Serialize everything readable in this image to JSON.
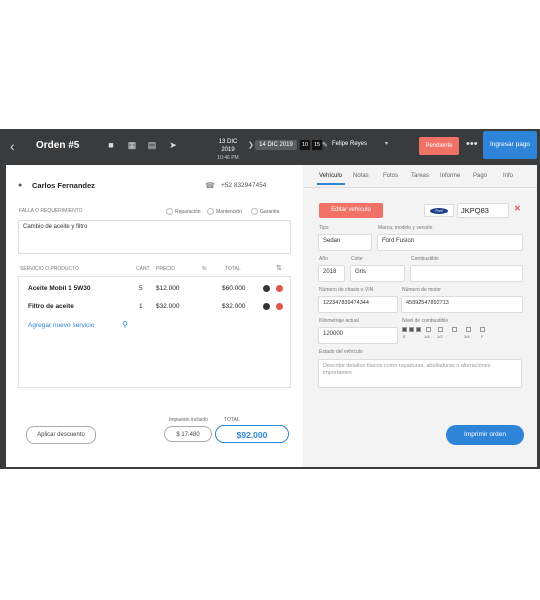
{
  "header": {
    "order_title": "Orden #5",
    "date_from_day": "13 DIC 2019",
    "date_from_time": "10:46 PM",
    "date_to": "14 DIC 2019",
    "hour": "10",
    "minute": "15",
    "user": "Felipe Reyes",
    "status_label": "Pendiente",
    "more": "•••",
    "pay_label": "Ingresar pago"
  },
  "customer": {
    "name": "Carlos Fernandez",
    "phone": "+52 832947454"
  },
  "request": {
    "label": "FALLA O REQUERIMIENTO",
    "options": [
      "Reparación",
      "Mantención",
      "Garantía"
    ],
    "text": "Cambio de aceite y filtro"
  },
  "services": {
    "headers": [
      "SERVICIO O PRODUCTO",
      "CANT",
      "PRECIO",
      "%",
      "TOTAL"
    ],
    "rows": [
      {
        "name": "Aceite Mobil 1 5W30",
        "qty": "5",
        "price": "$12.000",
        "total": "$60.000"
      },
      {
        "name": "Filtro de aceite",
        "qty": "1",
        "price": "$32.000",
        "total": "$32.000"
      }
    ],
    "add_label": "Agregar nuevo servicio"
  },
  "totals": {
    "discount_label": "Aplicar descuento",
    "tax_label": "Impuesto incluido",
    "tax_value": "$ 17.480",
    "total_label": "TOTAL",
    "total_value": "$92.000"
  },
  "vehicle": {
    "tabs": [
      "Vehículo",
      "Notas",
      "Fotos",
      "Tareas",
      "Informe",
      "Pago",
      "Info"
    ],
    "edit_label": "Editar vehículo",
    "brand_badge": "Ford",
    "plate": "JKPQ83",
    "type_label": "Tipo",
    "type_value": "Sedan",
    "model_label": "Marca, modelo y versión",
    "model_value": "Ford Fusion",
    "year_label": "Año",
    "year_value": "2018",
    "color_label": "Color",
    "color_value": "Gris",
    "fuel_type_label": "Combustible",
    "fuel_type_value": "",
    "vin_label": "Número de chasis o VIN",
    "vin_value": "1223478394743​44",
    "engine_label": "Número de motor",
    "engine_value": "458925478​92713",
    "km_label": "Kilometraje actual",
    "km_value": "120000",
    "fuel_level_label": "Nivel de combustible",
    "fuel_levels": [
      "E",
      "1/4",
      "1/2",
      "3/4",
      "F"
    ],
    "state_label": "Estado del vehículo",
    "state_placeholder": "Describe detalles físicos como rayaduras, abolladuras o alteraciones importantes",
    "print_label": "Imprimir orden"
  },
  "colors": {
    "accent": "#2d84d8",
    "danger": "#f07267",
    "dark": "#3a3b3d"
  }
}
